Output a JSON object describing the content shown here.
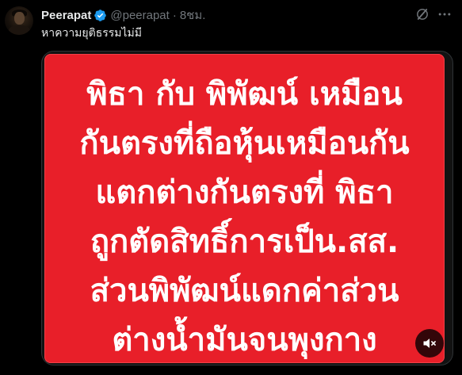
{
  "author": {
    "display_name": "Peerapat",
    "handle": "@peerapat",
    "separator": "·",
    "time": "8ชม.",
    "verified": true,
    "verified_color": "#1d9bf0"
  },
  "tweet": {
    "text": "หาความยุติธรรมไม่มี"
  },
  "media": {
    "type": "video",
    "background_color": "#e81f29",
    "text_color": "#ffffff",
    "lines": [
      "พิธา กับ พิพัฒน์ เหมือน",
      "กันตรงที่ถือหุ้นเหมือนกัน",
      "แตกต่างกันตรงที่ พิธา",
      "ถูกตัดสิทธิ์การเป็น.สส.",
      "ส่วนพิพัฒน์แดกค่าส่วน",
      "ต่างน้ำมันจนพุงกาง"
    ],
    "mute_icon": "speaker-muted-icon"
  },
  "icons": {
    "grok": "grok-icon",
    "more": "more-icon",
    "verified": "verified-badge-icon"
  }
}
